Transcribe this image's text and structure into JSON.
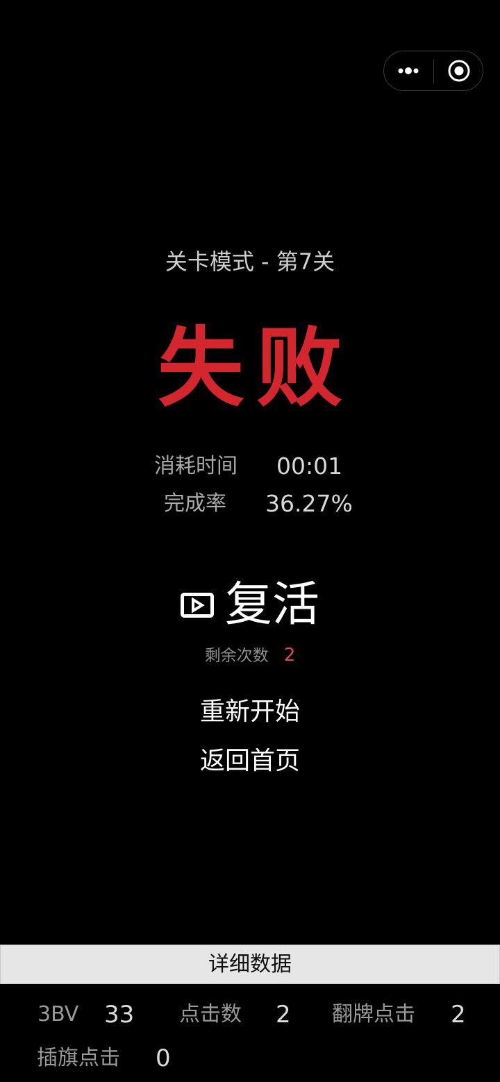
{
  "capsule": {
    "more_icon": "more-dots-icon",
    "close_icon": "target-circle-icon"
  },
  "game": {
    "level_title": "关卡模式 - 第7关",
    "result": "失败",
    "stats": {
      "time_label": "消耗时间",
      "time_value": "00:01",
      "completion_label": "完成率",
      "completion_value": "36.27%"
    },
    "revive": {
      "icon": "video-play-icon",
      "label": "复活",
      "remaining_label": "剩余次数",
      "remaining_count": "2"
    },
    "restart_label": "重新开始",
    "home_label": "返回首页"
  },
  "details": {
    "header": "详细数据",
    "items": [
      {
        "label": "3BV",
        "value": "33"
      },
      {
        "label": "点击数",
        "value": "2"
      },
      {
        "label": "翻牌点击",
        "value": "2"
      },
      {
        "label": "插旗点击",
        "value": "0"
      }
    ]
  },
  "colors": {
    "background": "#000000",
    "result_red": "#d6262d",
    "remaining_count": "#dd4560",
    "details_bar": "#e6e6e6"
  }
}
